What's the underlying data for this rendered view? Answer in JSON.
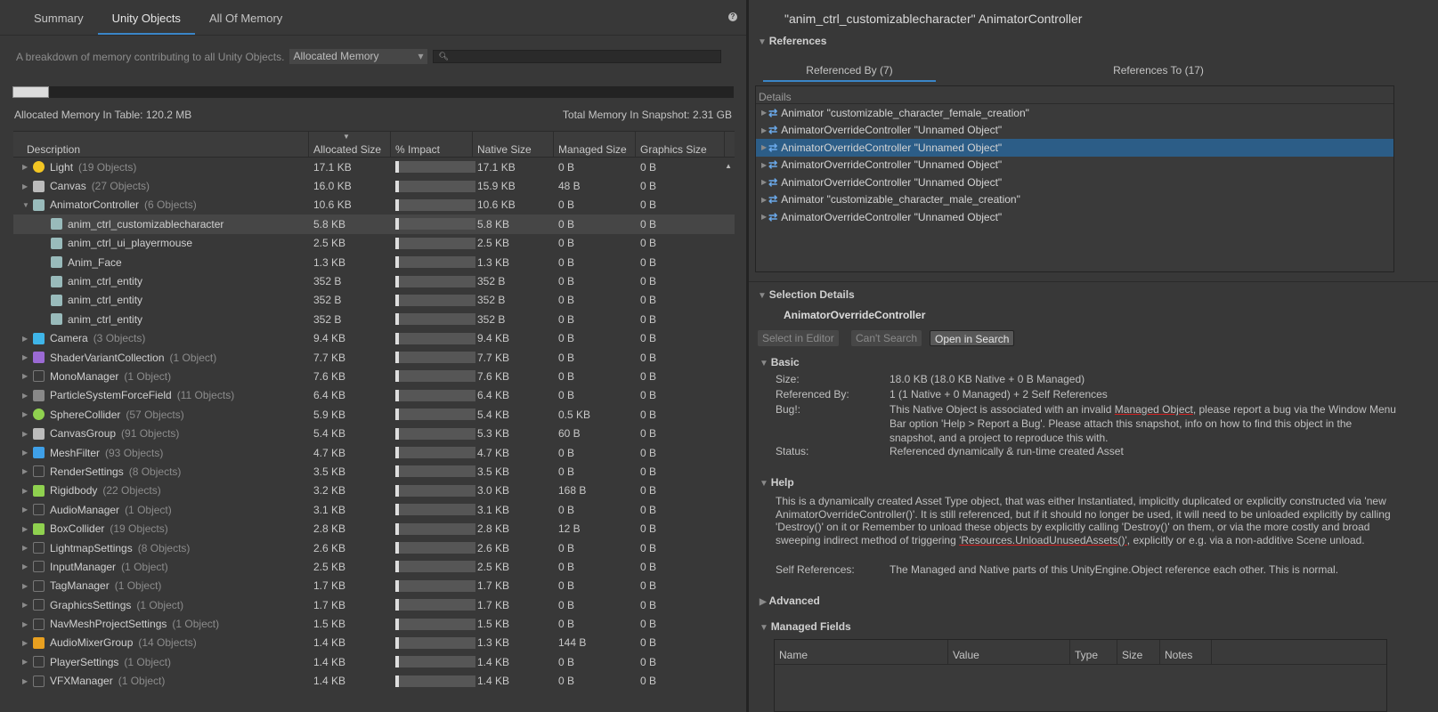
{
  "tabs": [
    "Summary",
    "Unity Objects",
    "All Of Memory"
  ],
  "description": "A breakdown of memory contributing to all Unity Objects.",
  "memory_dropdown": "Allocated Memory",
  "search_placeholder": "",
  "memory_bar_fraction": 0.05,
  "allocated_in_table": "Allocated Memory In Table: 120.2 MB",
  "total_in_snapshot": "Total Memory In Snapshot: 2.31 GB",
  "columns": [
    "Description",
    "Allocated Size",
    "% Impact",
    "Native Size",
    "Managed Size",
    "Graphics Size"
  ],
  "rows": [
    {
      "name": "Light",
      "count": "(19 Objects)",
      "alloc": "17.1 KB",
      "impact": 0.02,
      "native": "17.1 KB",
      "managed": "0 B",
      "graphics": "0 B",
      "icon": "light-icon",
      "color": "#f3c623",
      "level": 0,
      "exp": "▶"
    },
    {
      "name": "Canvas",
      "count": "(27 Objects)",
      "alloc": "16.0 KB",
      "impact": 0.02,
      "native": "15.9 KB",
      "managed": "48 B",
      "graphics": "0 B",
      "icon": "canvas-icon",
      "color": "#bbbbbb",
      "level": 0,
      "exp": "▶"
    },
    {
      "name": "AnimatorController",
      "count": "(6 Objects)",
      "alloc": "10.6 KB",
      "impact": 0.02,
      "native": "10.6 KB",
      "managed": "0 B",
      "graphics": "0 B",
      "icon": "animator-controller-icon",
      "color": "#9bb",
      "level": 0,
      "exp": "▼"
    },
    {
      "name": "anim_ctrl_customizablecharacter",
      "count": "",
      "alloc": "5.8 KB",
      "impact": 0.02,
      "native": "5.8 KB",
      "managed": "0 B",
      "graphics": "0 B",
      "icon": "animator-controller-icon",
      "color": "#9bb",
      "level": 1,
      "exp": ""
    },
    {
      "name": "anim_ctrl_ui_playermouse",
      "count": "",
      "alloc": "2.5 KB",
      "impact": 0.02,
      "native": "2.5 KB",
      "managed": "0 B",
      "graphics": "0 B",
      "icon": "animator-controller-icon",
      "color": "#9bb",
      "level": 1,
      "exp": ""
    },
    {
      "name": "Anim_Face",
      "count": "",
      "alloc": "1.3 KB",
      "impact": 0.02,
      "native": "1.3 KB",
      "managed": "0 B",
      "graphics": "0 B",
      "icon": "animator-controller-icon",
      "color": "#9bb",
      "level": 1,
      "exp": ""
    },
    {
      "name": "anim_ctrl_entity",
      "count": "",
      "alloc": "352 B",
      "impact": 0.02,
      "native": "352 B",
      "managed": "0 B",
      "graphics": "0 B",
      "icon": "animator-controller-icon",
      "color": "#9bb",
      "level": 1,
      "exp": ""
    },
    {
      "name": "anim_ctrl_entity",
      "count": "",
      "alloc": "352 B",
      "impact": 0.02,
      "native": "352 B",
      "managed": "0 B",
      "graphics": "0 B",
      "icon": "animator-controller-icon",
      "color": "#9bb",
      "level": 1,
      "exp": ""
    },
    {
      "name": "anim_ctrl_entity",
      "count": "",
      "alloc": "352 B",
      "impact": 0.02,
      "native": "352 B",
      "managed": "0 B",
      "graphics": "0 B",
      "icon": "animator-controller-icon",
      "color": "#9bb",
      "level": 1,
      "exp": ""
    },
    {
      "name": "Camera",
      "count": "(3 Objects)",
      "alloc": "9.4 KB",
      "impact": 0.02,
      "native": "9.4 KB",
      "managed": "0 B",
      "graphics": "0 B",
      "icon": "camera-icon",
      "color": "#3fb5e8",
      "level": 0,
      "exp": "▶"
    },
    {
      "name": "ShaderVariantCollection",
      "count": "(1 Object)",
      "alloc": "7.7 KB",
      "impact": 0.02,
      "native": "7.7 KB",
      "managed": "0 B",
      "graphics": "0 B",
      "icon": "shader-variant-icon",
      "color": "#9b6ad4",
      "level": 0,
      "exp": "▶"
    },
    {
      "name": "MonoManager",
      "count": "(1 Object)",
      "alloc": "7.6 KB",
      "impact": 0.02,
      "native": "7.6 KB",
      "managed": "0 B",
      "graphics": "0 B",
      "icon": "default-object-icon",
      "color": "#666",
      "level": 0,
      "exp": "▶"
    },
    {
      "name": "ParticleSystemForceField",
      "count": "(11 Objects)",
      "alloc": "6.4 KB",
      "impact": 0.02,
      "native": "6.4 KB",
      "managed": "0 B",
      "graphics": "0 B",
      "icon": "force-field-icon",
      "color": "#888",
      "level": 0,
      "exp": "▶"
    },
    {
      "name": "SphereCollider",
      "count": "(57 Objects)",
      "alloc": "5.9 KB",
      "impact": 0.02,
      "native": "5.4 KB",
      "managed": "0.5 KB",
      "graphics": "0 B",
      "icon": "sphere-collider-icon",
      "color": "#8fd14f",
      "level": 0,
      "exp": "▶"
    },
    {
      "name": "CanvasGroup",
      "count": "(91 Objects)",
      "alloc": "5.4 KB",
      "impact": 0.02,
      "native": "5.3 KB",
      "managed": "60 B",
      "graphics": "0 B",
      "icon": "canvas-group-icon",
      "color": "#bbbbbb",
      "level": 0,
      "exp": "▶"
    },
    {
      "name": "MeshFilter",
      "count": "(93 Objects)",
      "alloc": "4.7 KB",
      "impact": 0.02,
      "native": "4.7 KB",
      "managed": "0 B",
      "graphics": "0 B",
      "icon": "mesh-filter-icon",
      "color": "#3fa0e8",
      "level": 0,
      "exp": "▶"
    },
    {
      "name": "RenderSettings",
      "count": "(8 Objects)",
      "alloc": "3.5 KB",
      "impact": 0.02,
      "native": "3.5 KB",
      "managed": "0 B",
      "graphics": "0 B",
      "icon": "default-object-icon",
      "color": "#666",
      "level": 0,
      "exp": "▶"
    },
    {
      "name": "Rigidbody",
      "count": "(22 Objects)",
      "alloc": "3.2 KB",
      "impact": 0.02,
      "native": "3.0 KB",
      "managed": "168 B",
      "graphics": "0 B",
      "icon": "rigidbody-icon",
      "color": "#8fd14f",
      "level": 0,
      "exp": "▶"
    },
    {
      "name": "AudioManager",
      "count": "(1 Object)",
      "alloc": "3.1 KB",
      "impact": 0.02,
      "native": "3.1 KB",
      "managed": "0 B",
      "graphics": "0 B",
      "icon": "default-object-icon",
      "color": "#666",
      "level": 0,
      "exp": "▶"
    },
    {
      "name": "BoxCollider",
      "count": "(19 Objects)",
      "alloc": "2.8 KB",
      "impact": 0.02,
      "native": "2.8 KB",
      "managed": "12 B",
      "graphics": "0 B",
      "icon": "box-collider-icon",
      "color": "#8fd14f",
      "level": 0,
      "exp": "▶"
    },
    {
      "name": "LightmapSettings",
      "count": "(8 Objects)",
      "alloc": "2.6 KB",
      "impact": 0.02,
      "native": "2.6 KB",
      "managed": "0 B",
      "graphics": "0 B",
      "icon": "default-object-icon",
      "color": "#666",
      "level": 0,
      "exp": "▶"
    },
    {
      "name": "InputManager",
      "count": "(1 Object)",
      "alloc": "2.5 KB",
      "impact": 0.02,
      "native": "2.5 KB",
      "managed": "0 B",
      "graphics": "0 B",
      "icon": "default-object-icon",
      "color": "#666",
      "level": 0,
      "exp": "▶"
    },
    {
      "name": "TagManager",
      "count": "(1 Object)",
      "alloc": "1.7 KB",
      "impact": 0.02,
      "native": "1.7 KB",
      "managed": "0 B",
      "graphics": "0 B",
      "icon": "default-object-icon",
      "color": "#666",
      "level": 0,
      "exp": "▶"
    },
    {
      "name": "GraphicsSettings",
      "count": "(1 Object)",
      "alloc": "1.7 KB",
      "impact": 0.02,
      "native": "1.7 KB",
      "managed": "0 B",
      "graphics": "0 B",
      "icon": "default-object-icon",
      "color": "#666",
      "level": 0,
      "exp": "▶"
    },
    {
      "name": "NavMeshProjectSettings",
      "count": "(1 Object)",
      "alloc": "1.5 KB",
      "impact": 0.02,
      "native": "1.5 KB",
      "managed": "0 B",
      "graphics": "0 B",
      "icon": "default-object-icon",
      "color": "#666",
      "level": 0,
      "exp": "▶"
    },
    {
      "name": "AudioMixerGroup",
      "count": "(14 Objects)",
      "alloc": "1.4 KB",
      "impact": 0.02,
      "native": "1.3 KB",
      "managed": "144 B",
      "graphics": "0 B",
      "icon": "audio-mixer-group-icon",
      "color": "#e8a020",
      "level": 0,
      "exp": "▶"
    },
    {
      "name": "PlayerSettings",
      "count": "(1 Object)",
      "alloc": "1.4 KB",
      "impact": 0.02,
      "native": "1.4 KB",
      "managed": "0 B",
      "graphics": "0 B",
      "icon": "default-object-icon",
      "color": "#666",
      "level": 0,
      "exp": "▶"
    },
    {
      "name": "VFXManager",
      "count": "(1 Object)",
      "alloc": "1.4 KB",
      "impact": 0.02,
      "native": "1.4 KB",
      "managed": "0 B",
      "graphics": "0 B",
      "icon": "default-object-icon",
      "color": "#666",
      "level": 0,
      "exp": "▶"
    }
  ],
  "selected_row": 3,
  "right": {
    "title": "\"anim_ctrl_customizablecharacter\" AnimatorController",
    "references_label": "References",
    "ref_tabs": [
      "Referenced By (7)",
      "References To (17)"
    ],
    "details_label": "Details",
    "refs": [
      "Animator \"customizable_character_female_creation\"",
      "AnimatorOverrideController \"Unnamed Object\"",
      "AnimatorOverrideController \"Unnamed Object\"",
      "AnimatorOverrideController \"Unnamed Object\"",
      "AnimatorOverrideController \"Unnamed Object\"",
      "Animator \"customizable_character_male_creation\"",
      "AnimatorOverrideController \"Unnamed Object\""
    ],
    "selected_ref": 2,
    "selection_details_label": "Selection Details",
    "selection_name": "AnimatorOverrideController",
    "buttons": [
      "Select in Editor",
      "Can't Search",
      "Open in Search"
    ],
    "basic_label": "Basic",
    "size_k": "Size:",
    "size_v": "18.0 KB (18.0 KB Native + 0 B Managed)",
    "refby_k": "Referenced By:",
    "refby_v": "1 (1 Native + 0 Managed) + 2 Self References",
    "bug_k": "Bug!:",
    "bug_v1": "This Native Object is associated with an invalid ",
    "bug_v2": "Managed Object",
    "bug_v3": ", please report a bug via the Window Menu Bar option 'Help > Report a Bug'. Please attach this snapshot, info on how to find this object in the snapshot, and a project to reproduce this with.",
    "status_k": "Status:",
    "status_v": "Referenced dynamically & run-time created Asset",
    "help_label": "Help",
    "help_v1": "This is a dynamically created Asset Type object, that was either Instantiated, implicitly duplicated or explicitly constructed via 'new AnimatorOverrideController()'. It is still referenced, but if it should no longer be used, it will need to be unloaded explicitly by calling 'Destroy()' on it or Remember to unload these objects by explicitly calling 'Destroy()' on them, or via the more costly and broad sweeping indirect method of triggering ",
    "help_v2": "'Resources.UnloadUnusedAssets()'",
    "help_v3": ", explicitly or e.g. via a non-additive Scene unload.",
    "selfref_k": "Self References:",
    "selfref_v": "The Managed and Native parts of this UnityEngine.Object reference each other. This is normal.",
    "advanced_label": "Advanced",
    "managed_fields_label": "Managed Fields",
    "mf_columns": [
      "Name",
      "Value",
      "Type",
      "Size",
      "Notes"
    ]
  }
}
